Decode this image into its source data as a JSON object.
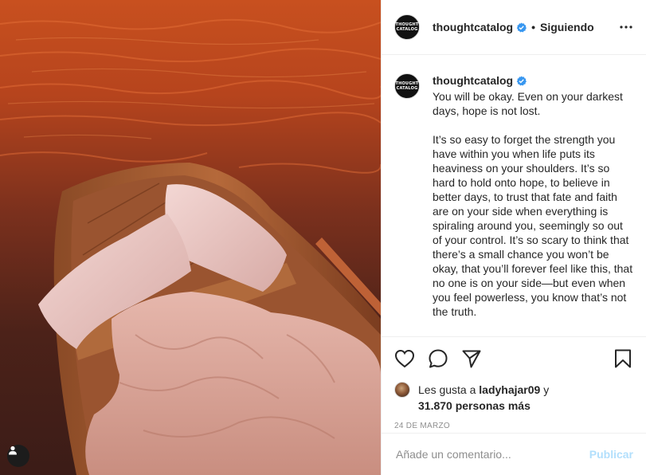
{
  "post": {
    "username": "thoughtcatalog",
    "avatar_text_line1": "THOUGHT",
    "avatar_text_line2": "CATALOG",
    "separator": "•",
    "follow_status": "Siguiendo",
    "caption_username": "thoughtcatalog",
    "caption": "You will be okay. Even on your darkest days, hope is not lost.\n\nIt’s so easy to forget the strength you have within you when life puts its heaviness on your shoulders. It’s so hard to hold onto hope, to believe in better days, to trust that fate and faith are on your side when everything is spiraling around you, seemingly so out of your control. It’s so scary to think that there’s a small chance you won’t be okay, that you’ll forever feel like this, that no one is on your side—but even when you feel powerless, you know that’s not the truth.",
    "likes_prefix": "Les gusta a ",
    "likes_user": "ladyhajar09",
    "likes_suffix": " y",
    "likes_others": "31.870 personas más",
    "date": "24 DE MARZO"
  },
  "comment": {
    "placeholder": "Añade un comentario...",
    "publish_label": "Publicar"
  },
  "icons": {
    "verified": "verified-badge-icon",
    "more": "more-options-icon",
    "like": "heart-icon",
    "comment": "comment-icon",
    "share": "share-icon",
    "save": "bookmark-icon",
    "user_tag": "user-tag-icon"
  },
  "colors": {
    "verified_blue": "#3897f0",
    "publish_disabled": "#b2dffc",
    "muted_text": "#8e8e8e",
    "border": "#efefef"
  }
}
